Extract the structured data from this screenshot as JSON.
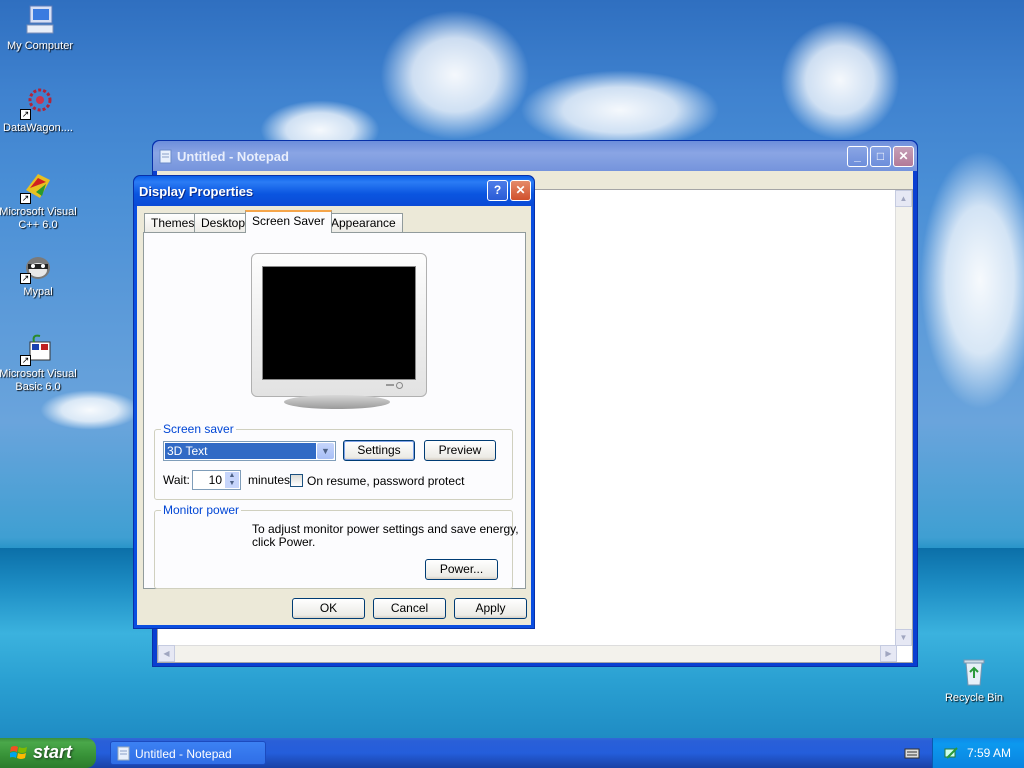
{
  "desktop": {
    "icons": [
      {
        "label": "My Computer",
        "icon": "my-computer-icon"
      },
      {
        "label": "DataWagon....",
        "icon": "datawagon-icon"
      },
      {
        "label": "Microsoft Visual C++ 6.0",
        "icon": "visual-cpp-icon"
      },
      {
        "label": "Mypal",
        "icon": "mypal-icon"
      },
      {
        "label": "Microsoft Visual Basic 6.0",
        "icon": "visual-basic-icon"
      },
      {
        "label": "Recycle Bin",
        "icon": "recycle-bin-icon"
      }
    ]
  },
  "notepad": {
    "title": "Untitled - Notepad"
  },
  "dialog": {
    "title": "Display Properties",
    "tabs": [
      "Themes",
      "Desktop",
      "Screen Saver",
      "Appearance"
    ],
    "active_tab": "Screen Saver",
    "screen_saver": {
      "group_label": "Screen saver",
      "selected": "3D Text",
      "settings_label": "Settings",
      "preview_label": "Preview",
      "wait_label": "Wait:",
      "wait_value": "10",
      "minutes_label": "minutes",
      "password_label": "On resume, password protect",
      "password_checked": false
    },
    "monitor_power": {
      "group_label": "Monitor power",
      "text_line1": "To adjust monitor power settings and save energy,",
      "text_line2": "click Power.",
      "power_label": "Power..."
    },
    "buttons": {
      "ok": "OK",
      "cancel": "Cancel",
      "apply": "Apply"
    },
    "help_glyph": "?",
    "close_glyph": "✕"
  },
  "taskbar": {
    "start_label": "start",
    "task_label": "Untitled - Notepad",
    "clock": "7:59 AM"
  },
  "colors": {
    "xp_blue": "#0a4ee0",
    "dialog_face": "#ece9d8",
    "selection": "#316ac5",
    "start_green": "#3c8f3c"
  }
}
